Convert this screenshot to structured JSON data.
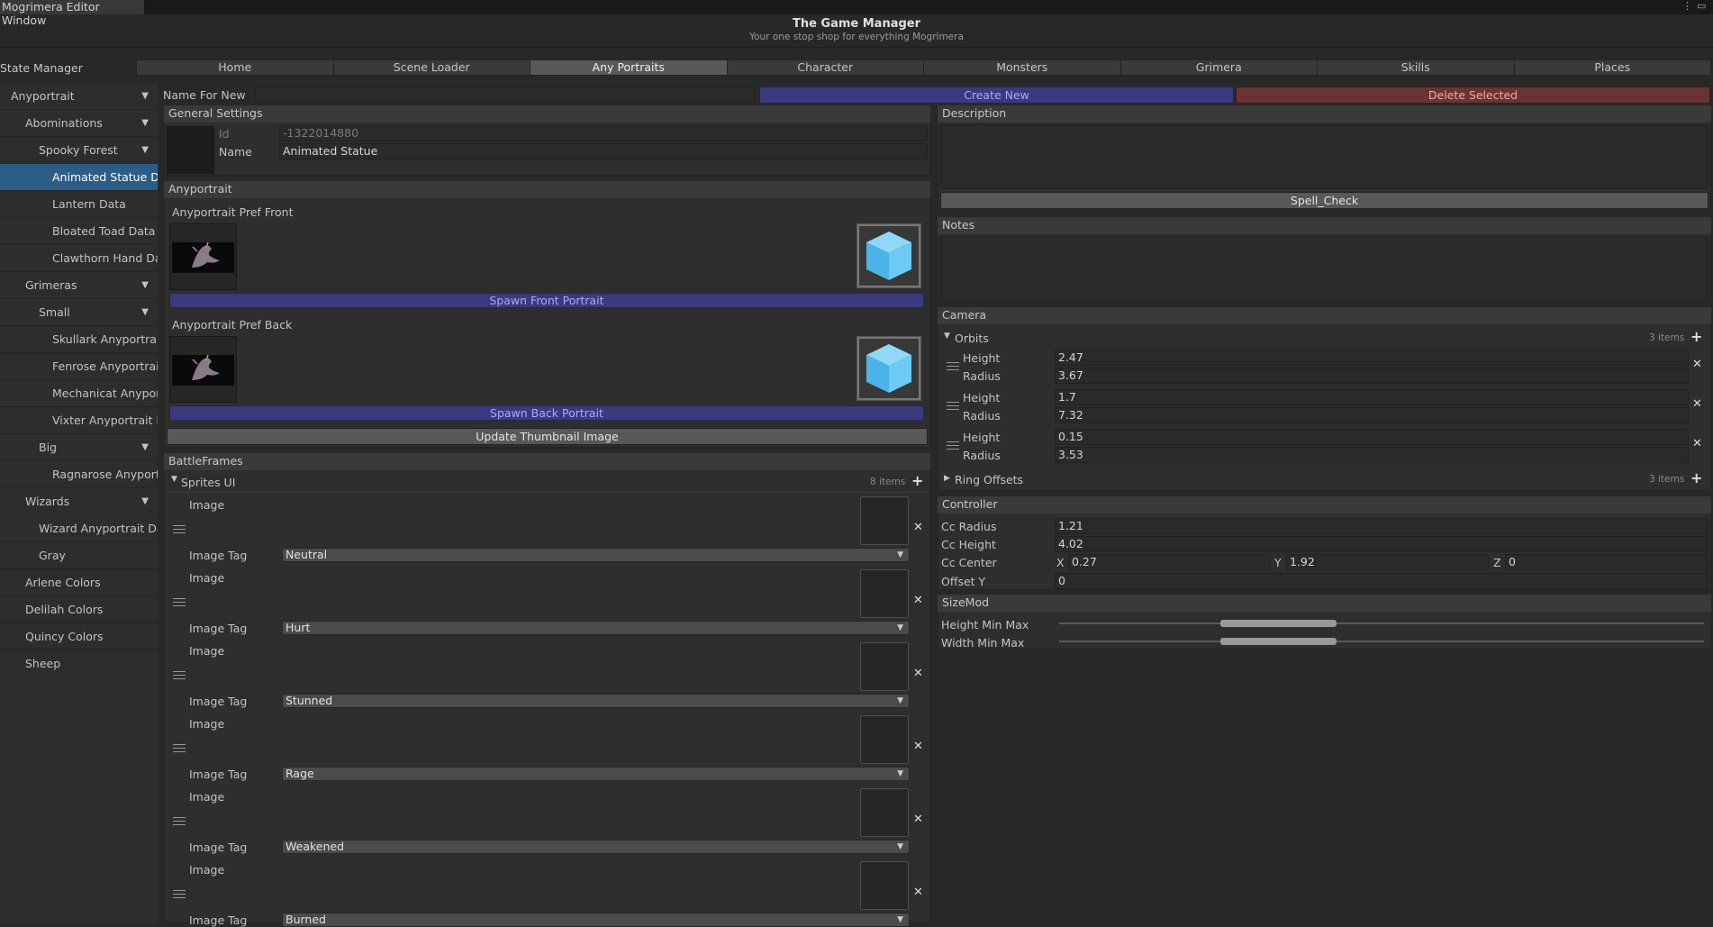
{
  "window": {
    "title": "Mogrimera Editor Window"
  },
  "header": {
    "title": "The Game Manager",
    "subtitle": "Your one stop shop for everything Mogrimera"
  },
  "state_manager": "State Manager",
  "tabs": [
    {
      "label": "Home"
    },
    {
      "label": "Scene Loader"
    },
    {
      "label": "Any Portraits"
    },
    {
      "label": "Character"
    },
    {
      "label": "Monsters"
    },
    {
      "label": "Grimera"
    },
    {
      "label": "Skills"
    },
    {
      "label": "Places"
    }
  ],
  "sidebar": {
    "items": [
      {
        "label": "Anyportrait",
        "expanded": true
      },
      {
        "label": "Abominations",
        "expanded": true
      },
      {
        "label": "Spooky Forest",
        "expanded": true
      },
      {
        "label": "Animated Statue Data"
      },
      {
        "label": "Lantern Data"
      },
      {
        "label": "Bloated Toad Data"
      },
      {
        "label": "Clawthorn Hand Data"
      },
      {
        "label": "Grimeras",
        "expanded": true
      },
      {
        "label": "Small",
        "expanded": true
      },
      {
        "label": "Skullark Anyportrait Data"
      },
      {
        "label": "Fenrose Anyportrait Data"
      },
      {
        "label": "Mechanicat Anyportrait Data"
      },
      {
        "label": "Vixter Anyportrait Data"
      },
      {
        "label": "Big",
        "expanded": true
      },
      {
        "label": "Ragnarose Anyportrait Data"
      },
      {
        "label": "Wizards",
        "expanded": true
      },
      {
        "label": "Wizard Anyportrait Data"
      },
      {
        "label": "Gray"
      },
      {
        "label": "Arlene Colors"
      },
      {
        "label": "Delilah Colors"
      },
      {
        "label": "Quincy Colors"
      },
      {
        "label": "Sheep"
      }
    ]
  },
  "toolbar": {
    "name_for_new_label": "Name For New",
    "name_for_new_value": "",
    "create_label": "Create New",
    "delete_label": "Delete Selected"
  },
  "general": {
    "header": "General Settings",
    "id_label": "Id",
    "id_value": "-1322014880",
    "name_label": "Name",
    "name_value": "Animated Statue"
  },
  "anyportrait": {
    "header": "Anyportrait",
    "front_label": "Anyportrait Pref Front",
    "spawn_front": "Spawn Front Portrait",
    "back_label": "Anyportrait Pref Back",
    "spawn_back": "Spawn Back Portrait",
    "update_thumb": "Update Thumbnail Image"
  },
  "battleframes": {
    "header": "BattleFrames",
    "sprites_label": "Sprites UI",
    "count": "8 items",
    "image_label": "Image",
    "tag_label": "Image Tag",
    "tags": [
      "Neutral",
      "Hurt",
      "Stunned",
      "Rage",
      "Weakened",
      "Burned"
    ]
  },
  "description": {
    "header": "Description",
    "value": "",
    "spell_check": "Spell_Check"
  },
  "notes": {
    "header": "Notes",
    "value": ""
  },
  "camera": {
    "header": "Camera",
    "orbits_label": "Orbits",
    "orbits_count": "3 items",
    "height_label": "Height",
    "radius_label": "Radius",
    "orbits": [
      {
        "height": "2.47",
        "radius": "3.67"
      },
      {
        "height": "1.7",
        "radius": "7.32"
      },
      {
        "height": "0.15",
        "radius": "3.53"
      }
    ],
    "ring_label": "Ring Offsets",
    "ring_count": "3 items"
  },
  "controller": {
    "header": "Controller",
    "cc_radius_label": "Cc Radius",
    "cc_radius": "1.21",
    "cc_height_label": "Cc Height",
    "cc_height": "4.02",
    "cc_center_label": "Cc Center",
    "x_label": "X",
    "x": "0.27",
    "y_label": "Y",
    "y": "1.92",
    "z_label": "Z",
    "z": "0",
    "offset_y_label": "Offset Y",
    "offset_y": "0"
  },
  "sizemod": {
    "header": "SizeMod",
    "height_label": "Height Min Max",
    "width_label": "Width Min Max",
    "height_range": [
      0.25,
      0.43
    ],
    "width_range": [
      0.25,
      0.43
    ]
  },
  "colors": {
    "accent": "#2c5d87",
    "create": "#3a3a7e",
    "delete": "#6a3434"
  }
}
